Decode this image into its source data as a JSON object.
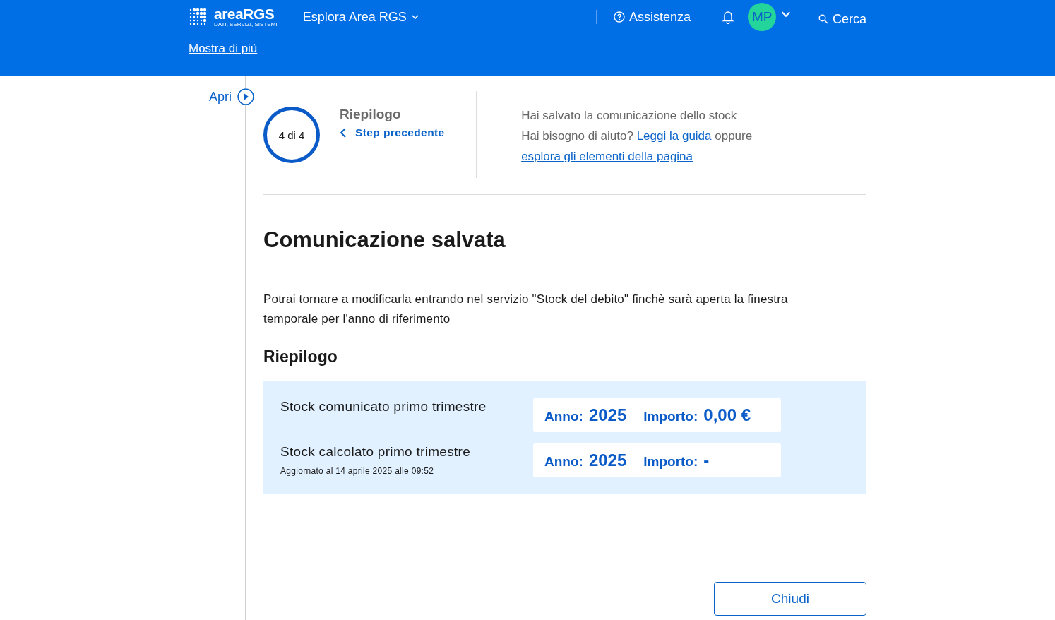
{
  "header": {
    "logo": {
      "name": "areaRGS",
      "tagline": "DATI, SERVIZI, SISTEMI."
    },
    "explore": "Esplora Area RGS",
    "help": "Assistenza",
    "avatar": "MP",
    "search": "Cerca",
    "more": "Mostra di più"
  },
  "sidebar": {
    "toggle": "Apri"
  },
  "stepper": {
    "counter": "4 di 4",
    "title": "Riepilogo",
    "back": "Step precedente"
  },
  "info": {
    "status": "Hai salvato la comunicazione dello stock",
    "help": [
      {
        "kind": "text",
        "text": "Hai bisogno di aiuto? "
      },
      {
        "kind": "link",
        "text": "Leggi la guida"
      },
      {
        "kind": "text",
        "text": " oppure "
      },
      {
        "kind": "link",
        "text": "esplora gli elementi della pagina"
      }
    ]
  },
  "title": "Comunicazione salvata",
  "description": "Potrai tornare a modificarla entrando nel servizio \"Stock del debito\" finchè sarà aperta la finestra temporale per l'anno di riferimento",
  "summary": {
    "title": "Riepilogo",
    "rows": [
      {
        "label": "Stock comunicato primo trimestre",
        "year_label": "Anno:",
        "year": "2025",
        "amount_label": "Importo:",
        "amount": "0,00 €"
      },
      {
        "label": "Stock calcolato primo trimestre",
        "note": "Aggiornato al 14 aprile 2025 alle 09:52",
        "year_label": "Anno:",
        "year": "2025",
        "amount_label": "Importo:",
        "amount": "-"
      }
    ]
  },
  "buttons": [
    {
      "label": "Chiudi"
    }
  ]
}
